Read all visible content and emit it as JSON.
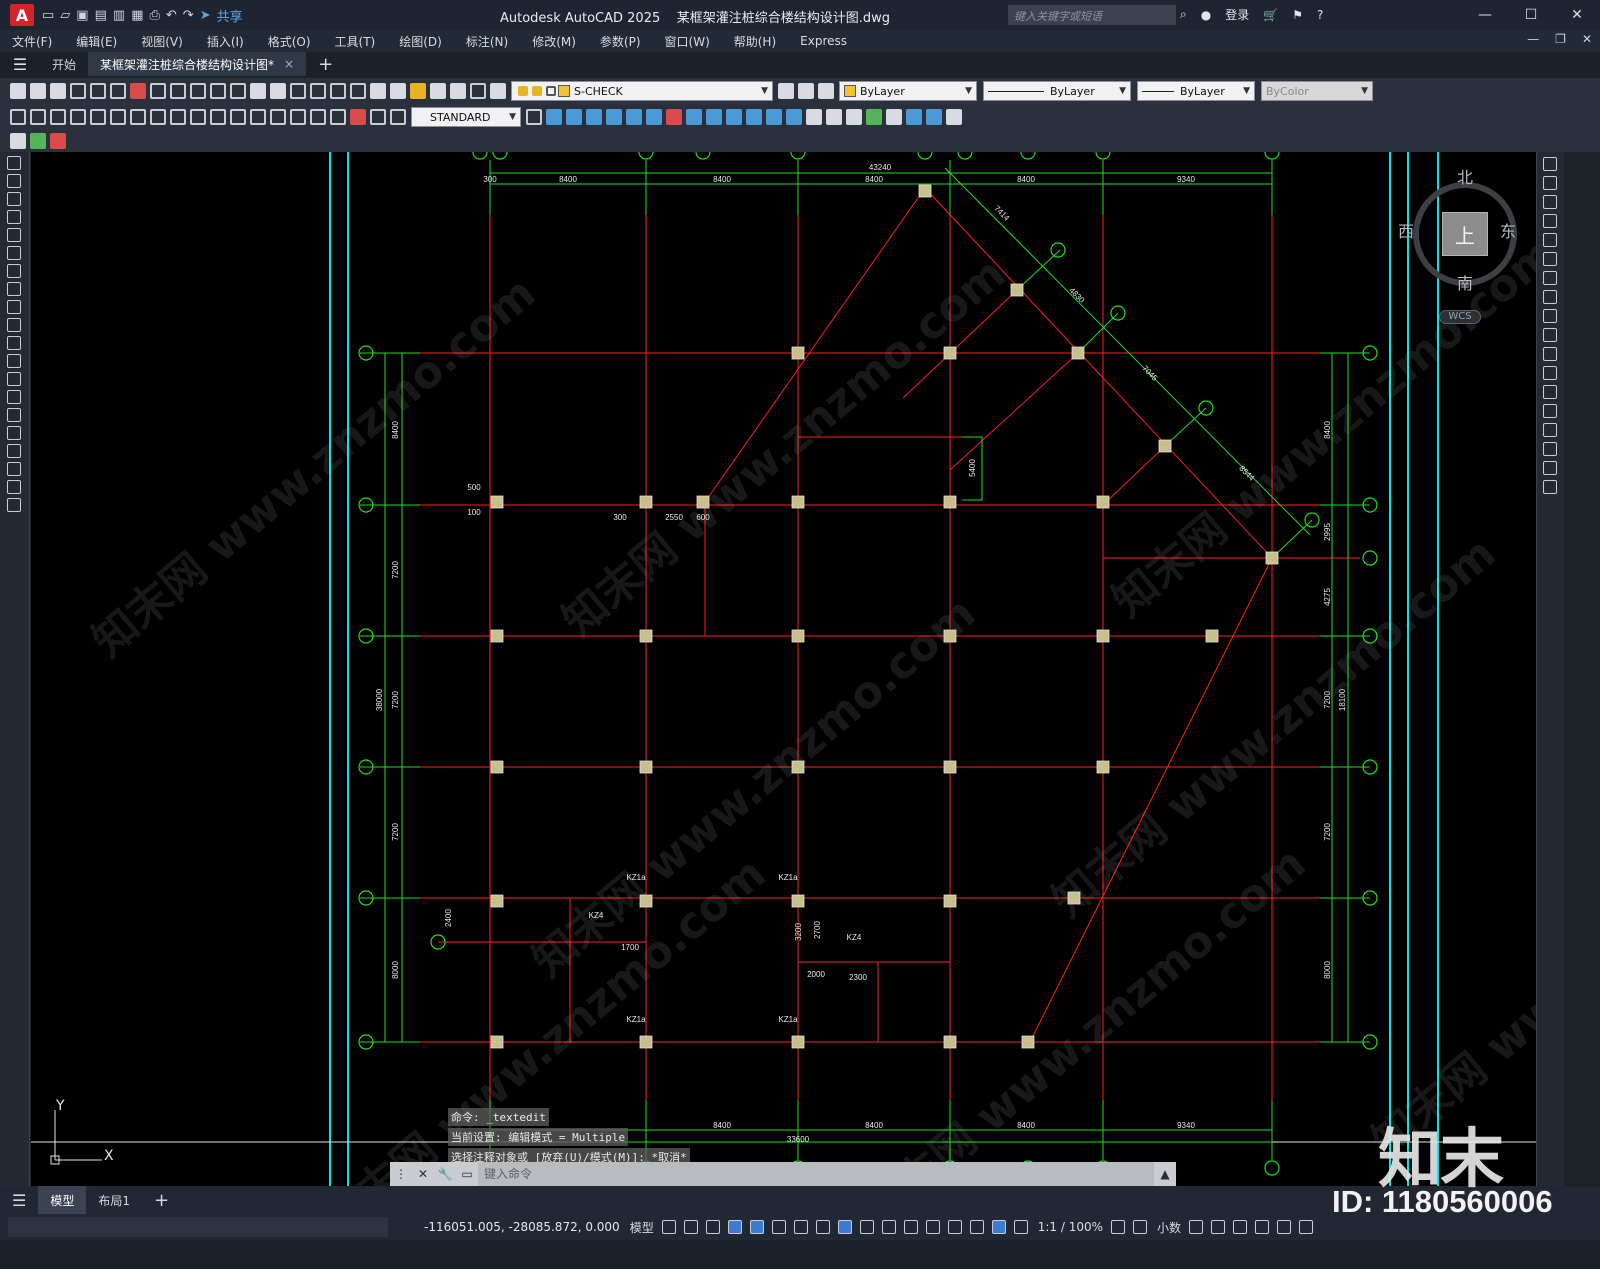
{
  "app": {
    "window_title": "Autodesk AutoCAD 2025",
    "doc_title": "某框架灌注桩综合楼结构设计图.dwg",
    "share_label": "共享",
    "search_placeholder": "键入关键字或短语",
    "login_label": "登录"
  },
  "menu": [
    "文件(F)",
    "编辑(E)",
    "视图(V)",
    "插入(I)",
    "格式(O)",
    "工具(T)",
    "绘图(D)",
    "标注(N)",
    "修改(M)",
    "参数(P)",
    "窗口(W)",
    "帮助(H)",
    "Express"
  ],
  "tabs": {
    "start": "开始",
    "document": "某框架灌注桩综合楼结构设计图*",
    "close": "×"
  },
  "toolbar": {
    "layer_name": "S-CHECK",
    "color": "ByLayer",
    "linetype": "ByLayer",
    "lineweight": "ByLayer",
    "plotstyle": "ByColor",
    "dimstyle": "STANDARD"
  },
  "viewcube": {
    "north": "北",
    "south": "南",
    "east": "东",
    "west": "西",
    "top": "上",
    "wcs": "WCS"
  },
  "ucs": {
    "x": "X",
    "y": "Y"
  },
  "command_history": [
    "命令:  _textedit",
    "当前设置: 编辑模式 = Multiple",
    "选择注释对象或 [放弃(U)/模式(M)]: *取消*"
  ],
  "command_placeholder": "键入命令",
  "layout_tabs": {
    "model": "模型",
    "layout1": "布局1"
  },
  "status": {
    "coords": "-116051.005, -28085.872, 0.000",
    "model": "模型",
    "scale": "1:1 / 100%",
    "units": "小数"
  },
  "watermark": {
    "logo": "知末",
    "id": "ID: 1180560006",
    "site": "知末网 www.znzmo.com"
  },
  "drawing": {
    "top_dims": [
      "300",
      "8400",
      "8400",
      "8400",
      "43240",
      "8400",
      "9340"
    ],
    "bottom_dims": [
      "8400",
      "8400",
      "8400",
      "9340"
    ],
    "bottom_total": "33600",
    "left_dims": [
      "8400",
      "7200",
      "7200",
      "7200",
      "8000"
    ],
    "left_total": "38000",
    "right_dims": [
      "8400",
      "2995",
      "4275",
      "7200",
      "7200",
      "8000"
    ],
    "right_total": "18100",
    "diag_dims": [
      "7414",
      "4830",
      "7045",
      "8544"
    ],
    "col_labels": [
      "KZ1a",
      "KZ1a",
      "KZ4",
      "KZ4",
      "KZ1a",
      "KZ1a"
    ],
    "small_dims": [
      "500",
      "100",
      "300",
      "2550",
      "600",
      "5400",
      "2400",
      "3200",
      "2700",
      "1700",
      "2000",
      "2300"
    ]
  },
  "colors": {
    "axis": "#ff2020",
    "dimension": "#20e020",
    "border": "#00e5e5",
    "column_fill": "#c8c08a"
  }
}
